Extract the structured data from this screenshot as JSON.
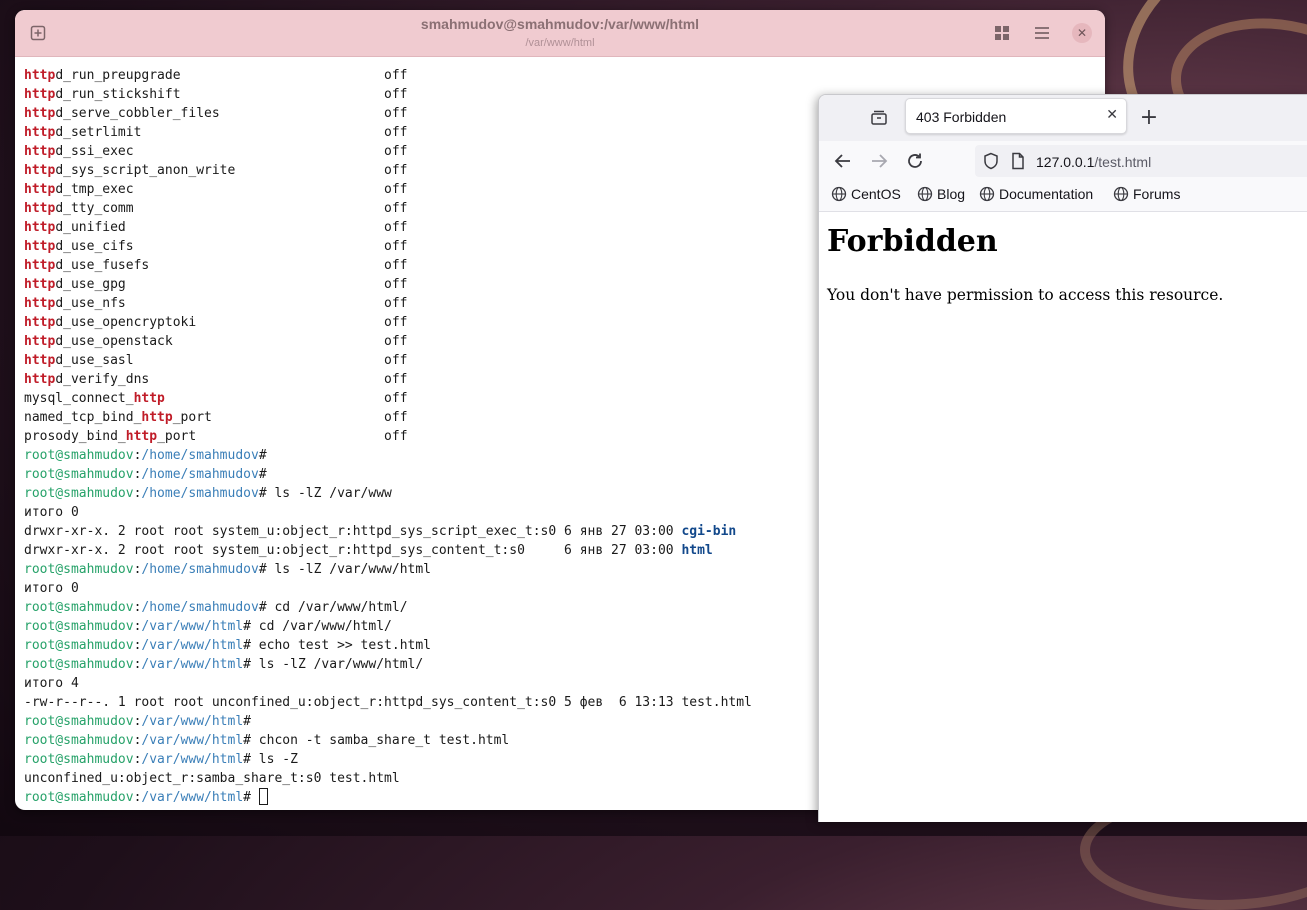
{
  "terminal": {
    "title": "smahmudov@smahmudov:/var/www/html",
    "subtitle": "/var/www/html",
    "lines": [
      {
        "segs": [
          {
            "t": "http",
            "c": "kw"
          },
          {
            "t": "d_run_preupgrade                          off"
          }
        ]
      },
      {
        "segs": [
          {
            "t": "http",
            "c": "kw"
          },
          {
            "t": "d_run_stickshift                          off"
          }
        ]
      },
      {
        "segs": [
          {
            "t": "http",
            "c": "kw"
          },
          {
            "t": "d_serve_cobbler_files                     off"
          }
        ]
      },
      {
        "segs": [
          {
            "t": "http",
            "c": "kw"
          },
          {
            "t": "d_setrlimit                               off"
          }
        ]
      },
      {
        "segs": [
          {
            "t": "http",
            "c": "kw"
          },
          {
            "t": "d_ssi_exec                                off"
          }
        ]
      },
      {
        "segs": [
          {
            "t": "http",
            "c": "kw"
          },
          {
            "t": "d_sys_script_anon_write                   off"
          }
        ]
      },
      {
        "segs": [
          {
            "t": "http",
            "c": "kw"
          },
          {
            "t": "d_tmp_exec                                off"
          }
        ]
      },
      {
        "segs": [
          {
            "t": "http",
            "c": "kw"
          },
          {
            "t": "d_tty_comm                                off"
          }
        ]
      },
      {
        "segs": [
          {
            "t": "http",
            "c": "kw"
          },
          {
            "t": "d_unified                                 off"
          }
        ]
      },
      {
        "segs": [
          {
            "t": "http",
            "c": "kw"
          },
          {
            "t": "d_use_cifs                                off"
          }
        ]
      },
      {
        "segs": [
          {
            "t": "http",
            "c": "kw"
          },
          {
            "t": "d_use_fusefs                              off"
          }
        ]
      },
      {
        "segs": [
          {
            "t": "http",
            "c": "kw"
          },
          {
            "t": "d_use_gpg                                 off"
          }
        ]
      },
      {
        "segs": [
          {
            "t": "http",
            "c": "kw"
          },
          {
            "t": "d_use_nfs                                 off"
          }
        ]
      },
      {
        "segs": [
          {
            "t": "http",
            "c": "kw"
          },
          {
            "t": "d_use_opencryptoki                        off"
          }
        ]
      },
      {
        "segs": [
          {
            "t": "http",
            "c": "kw"
          },
          {
            "t": "d_use_openstack                           off"
          }
        ]
      },
      {
        "segs": [
          {
            "t": "http",
            "c": "kw"
          },
          {
            "t": "d_use_sasl                                off"
          }
        ]
      },
      {
        "segs": [
          {
            "t": "http",
            "c": "kw"
          },
          {
            "t": "d_verify_dns                              off"
          }
        ]
      },
      {
        "segs": [
          {
            "t": "mysql_connect_"
          },
          {
            "t": "http",
            "c": "kw"
          },
          {
            "t": "                            off"
          }
        ]
      },
      {
        "segs": [
          {
            "t": "named_tcp_bind_"
          },
          {
            "t": "http",
            "c": "kw"
          },
          {
            "t": "_port                      off"
          }
        ]
      },
      {
        "segs": [
          {
            "t": "prosody_bind_"
          },
          {
            "t": "http",
            "c": "kw"
          },
          {
            "t": "_port                        off"
          }
        ]
      },
      {
        "segs": [
          {
            "t": "root@smahmudov",
            "c": "pu"
          },
          {
            "t": ":"
          },
          {
            "t": "/home/smahmudov",
            "c": "ph"
          },
          {
            "t": "#"
          }
        ]
      },
      {
        "segs": [
          {
            "t": "root@smahmudov",
            "c": "pu"
          },
          {
            "t": ":"
          },
          {
            "t": "/home/smahmudov",
            "c": "ph"
          },
          {
            "t": "#"
          }
        ]
      },
      {
        "segs": [
          {
            "t": "root@smahmudov",
            "c": "pu"
          },
          {
            "t": ":"
          },
          {
            "t": "/home/smahmudov",
            "c": "ph"
          },
          {
            "t": "# ls -lZ /var/www"
          }
        ]
      },
      {
        "segs": [
          {
            "t": "итого 0"
          }
        ]
      },
      {
        "segs": [
          {
            "t": "drwxr-xr-x. 2 root root system_u:object_r:httpd_sys_script_exec_t:s0 6 янв 27 03:00 "
          },
          {
            "t": "cgi-bin",
            "c": "dirn"
          }
        ]
      },
      {
        "segs": [
          {
            "t": "drwxr-xr-x. 2 root root system_u:object_r:httpd_sys_content_t:s0     6 янв 27 03:00 "
          },
          {
            "t": "html",
            "c": "dirn"
          }
        ]
      },
      {
        "segs": [
          {
            "t": "root@smahmudov",
            "c": "pu"
          },
          {
            "t": ":"
          },
          {
            "t": "/home/smahmudov",
            "c": "ph"
          },
          {
            "t": "# ls -lZ /var/www/html"
          }
        ]
      },
      {
        "segs": [
          {
            "t": "итого 0"
          }
        ]
      },
      {
        "segs": [
          {
            "t": "root@smahmudov",
            "c": "pu"
          },
          {
            "t": ":"
          },
          {
            "t": "/home/smahmudov",
            "c": "ph"
          },
          {
            "t": "# cd /var/www/html/"
          }
        ]
      },
      {
        "segs": [
          {
            "t": "root@smahmudov",
            "c": "pu"
          },
          {
            "t": ":"
          },
          {
            "t": "/var/www/html",
            "c": "ph"
          },
          {
            "t": "# cd /var/www/html/"
          }
        ]
      },
      {
        "segs": [
          {
            "t": "root@smahmudov",
            "c": "pu"
          },
          {
            "t": ":"
          },
          {
            "t": "/var/www/html",
            "c": "ph"
          },
          {
            "t": "# echo test >> test.html"
          }
        ]
      },
      {
        "segs": [
          {
            "t": "root@smahmudov",
            "c": "pu"
          },
          {
            "t": ":"
          },
          {
            "t": "/var/www/html",
            "c": "ph"
          },
          {
            "t": "# ls -lZ /var/www/html/"
          }
        ]
      },
      {
        "segs": [
          {
            "t": "итого 4"
          }
        ]
      },
      {
        "segs": [
          {
            "t": "-rw-r--r--. 1 root root unconfined_u:object_r:httpd_sys_content_t:s0 5 фев  6 13:13 test.html"
          }
        ]
      },
      {
        "segs": [
          {
            "t": "root@smahmudov",
            "c": "pu"
          },
          {
            "t": ":"
          },
          {
            "t": "/var/www/html",
            "c": "ph"
          },
          {
            "t": "#"
          }
        ]
      },
      {
        "segs": [
          {
            "t": "root@smahmudov",
            "c": "pu"
          },
          {
            "t": ":"
          },
          {
            "t": "/var/www/html",
            "c": "ph"
          },
          {
            "t": "# chcon -t samba_share_t test.html"
          }
        ]
      },
      {
        "segs": [
          {
            "t": "root@smahmudov",
            "c": "pu"
          },
          {
            "t": ":"
          },
          {
            "t": "/var/www/html",
            "c": "ph"
          },
          {
            "t": "# ls -Z"
          }
        ]
      },
      {
        "segs": [
          {
            "t": "unconfined_u:object_r:samba_share_t:s0 test.html"
          }
        ]
      },
      {
        "segs": [
          {
            "t": "root@smahmudov",
            "c": "pu"
          },
          {
            "t": ":"
          },
          {
            "t": "/var/www/html",
            "c": "ph"
          },
          {
            "t": "# "
          }
        ],
        "cursor": true
      }
    ]
  },
  "browser": {
    "tab_title": "403 Forbidden",
    "url_host": "127.0.0.1",
    "url_path": "/test.html",
    "bookmarks": [
      "CentOS",
      "Blog",
      "Documentation",
      "Forums"
    ],
    "page_heading": "Forbidden",
    "page_text": "You don't have permission to access this resource."
  },
  "colors": {
    "terminal_header": "#f0cbd0",
    "keyword_red": "#c01c28",
    "prompt_user_green": "#26a269",
    "prompt_path_blue": "#3b7fb8",
    "dir_blue": "#12488b"
  }
}
